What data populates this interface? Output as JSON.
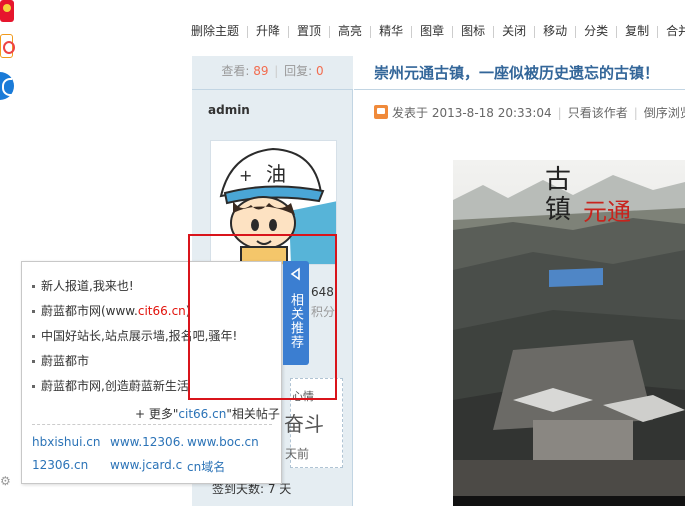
{
  "toolbar": {
    "items": [
      "删除主题",
      "升降",
      "置顶",
      "高亮",
      "精华",
      "图章",
      "图标",
      "关闭",
      "移动",
      "分类",
      "复制",
      "合并"
    ]
  },
  "stats": {
    "views_label": "查看:",
    "views": "89",
    "replies_label": "回复:",
    "replies": "0"
  },
  "post": {
    "title": "崇州元通古镇，一座似被历史遗忘的古镇！",
    "meta_published": "发表于 2013-8-18 20:33:04",
    "meta_author_only": "只看该作者",
    "meta_order": "倒序浏览"
  },
  "author": {
    "name": "admin",
    "points": "648",
    "points_label": "积分",
    "signature_line": "心情",
    "signature_big": "奋斗",
    "signature_time": "天前",
    "signin": "签到天数: 7 天"
  },
  "popup": {
    "items": [
      {
        "text": "新人报道,我来也!",
        "hl": "",
        "suffix": ""
      },
      {
        "text": "蔚蓝都市网(www.",
        "hl": "cit66.cn",
        "suffix": ")"
      },
      {
        "text": "中国好站长,站点展示墙,报名吧,骚年!",
        "hl": "",
        "suffix": ""
      },
      {
        "text": "蔚蓝都市",
        "hl": "",
        "suffix": ""
      },
      {
        "text": "蔚蓝都市网,创造蔚蓝新生活",
        "hl": "",
        "suffix": ""
      }
    ],
    "more_prefix": "+ 更多\"",
    "more_site": "cit66.cn",
    "more_suffix": "\"相关帖子",
    "links": [
      "hbxishui.cn",
      "www.12306.",
      "www.boc.cn",
      "12306.cn",
      "www.jcard.cn",
      "cn域名"
    ]
  },
  "recommend_tab": {
    "label": "相关推荐"
  },
  "photo": {
    "overlay_text_1": "古",
    "overlay_text_2": "镇",
    "overlay_text_red": "元通"
  }
}
